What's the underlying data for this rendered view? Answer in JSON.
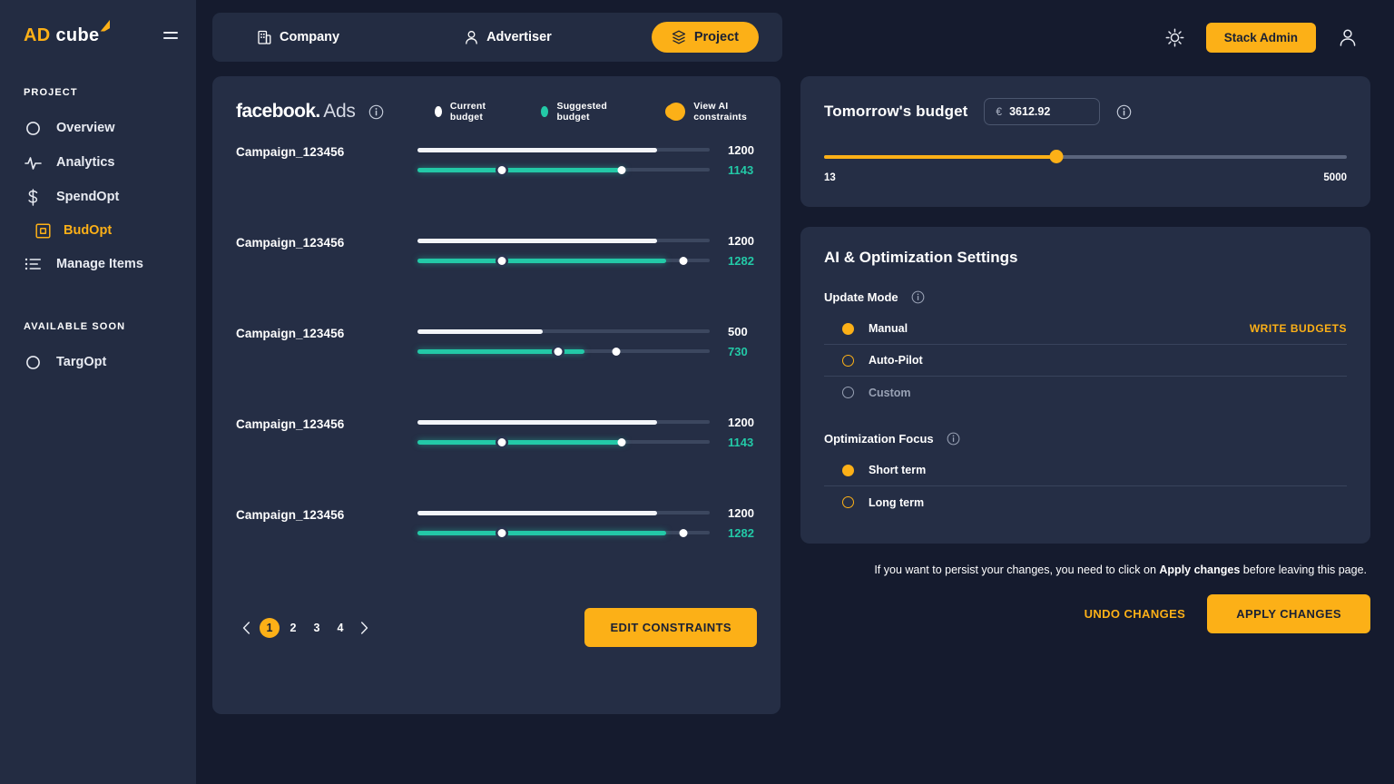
{
  "brand": {
    "ad": "AD",
    "cube": "cube"
  },
  "sidebar": {
    "section_project": "PROJECT",
    "section_soon": "AVAILABLE SOON",
    "items": [
      {
        "label": "Overview",
        "icon": "circle-icon"
      },
      {
        "label": "Analytics",
        "icon": "pulse-icon"
      },
      {
        "label": "SpendOpt",
        "icon": "dollar-icon"
      },
      {
        "label": "BudOpt",
        "icon": "square-target-icon"
      },
      {
        "label": "Manage Items",
        "icon": "list-icon"
      }
    ],
    "soon_items": [
      {
        "label": "TargOpt",
        "icon": "circle-icon"
      }
    ]
  },
  "topbar": {
    "tabs": [
      {
        "label": "Company",
        "icon": "building-icon",
        "active": false
      },
      {
        "label": "Advertiser",
        "icon": "person-icon",
        "active": false
      },
      {
        "label": "Project",
        "icon": "layers-icon",
        "active": true
      }
    ],
    "settings_icon": "gear-icon",
    "stack_admin": "Stack Admin",
    "account_icon": "person-icon"
  },
  "campaigns_panel": {
    "platform_bold": "facebook",
    "platform_dot": ".",
    "platform_light": "Ads",
    "info_icon": "info-icon",
    "legend_current": "Current budget",
    "legend_suggested": "Suggested budget",
    "toggle_label": "View AI constraints",
    "toggle_on": true,
    "rows": [
      {
        "name": "Campaign_123456",
        "current": "1200",
        "suggested": "1143",
        "current_pct": 82,
        "sug_fill_pct": 71,
        "handle1_pct": 29,
        "handle2_pct": 70
      },
      {
        "name": "Campaign_123456",
        "current": "1200",
        "suggested": "1282",
        "current_pct": 82,
        "sug_fill_pct": 85,
        "handle1_pct": 29,
        "handle2_pct": 91
      },
      {
        "name": "Campaign_123456",
        "current": "500",
        "suggested": "730",
        "current_pct": 43,
        "sug_fill_pct": 57,
        "handle1_pct": 48,
        "handle2_pct": 68
      },
      {
        "name": "Campaign_123456",
        "current": "1200",
        "suggested": "1143",
        "current_pct": 82,
        "sug_fill_pct": 71,
        "handle1_pct": 29,
        "handle2_pct": 70
      },
      {
        "name": "Campaign_123456",
        "current": "1200",
        "suggested": "1282",
        "current_pct": 82,
        "sug_fill_pct": 85,
        "handle1_pct": 29,
        "handle2_pct": 91
      }
    ],
    "pagination": {
      "prev": "‹",
      "pages": [
        "1",
        "2",
        "3",
        "4"
      ],
      "active": "1",
      "next": "›"
    },
    "edit_constraints": "EDIT CONSTRAINTS"
  },
  "budget_panel": {
    "title": "Tomorrow's budget",
    "currency": "€",
    "value": "3612.92",
    "info_icon": "info-icon",
    "min": "13",
    "max": "5000",
    "slider_pct": 44.5
  },
  "ai_panel": {
    "title": "AI & Optimization Settings",
    "update_mode_label": "Update Mode",
    "update_mode_info": "info-icon",
    "update_modes": [
      {
        "label": "Manual",
        "state": "on",
        "action": "WRITE BUDGETS"
      },
      {
        "label": "Auto-Pilot",
        "state": "off",
        "action": ""
      },
      {
        "label": "Custom",
        "state": "disabled",
        "action": ""
      }
    ],
    "focus_label": "Optimization Focus",
    "focus_info": "info-icon",
    "focus_options": [
      {
        "label": "Short term",
        "state": "on"
      },
      {
        "label": "Long term",
        "state": "off"
      }
    ]
  },
  "actions": {
    "note_prefix": "If you want to persist your changes, you need to click on ",
    "note_bold": "Apply changes",
    "note_suffix": " before leaving this page.",
    "undo": "UNDO CHANGES",
    "apply": "APPLY CHANGES"
  },
  "colors": {
    "accent": "#fcb017",
    "teal": "#23c9a7",
    "sidebar_bg": "#232c42",
    "page_bg": "#151b2e",
    "card_bg": "#252e45"
  }
}
